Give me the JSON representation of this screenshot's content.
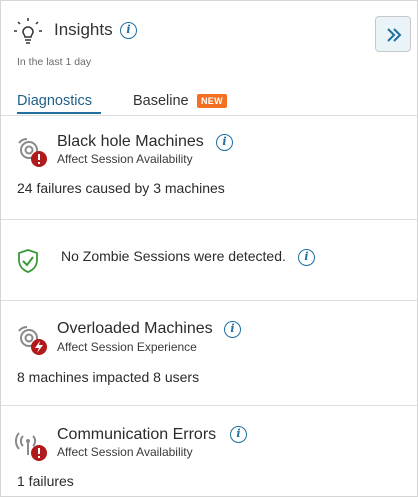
{
  "header": {
    "title": "Insights",
    "subtitle": "In the last 1 day",
    "icon": "lightbulb-icon",
    "collapse_icon": "double-chevron-right-icon"
  },
  "tabs": [
    {
      "label": "Diagnostics",
      "active": true
    },
    {
      "label": "Baseline",
      "badge": "NEW"
    }
  ],
  "cards": [
    {
      "title": "Black hole Machines",
      "subtitle": "Affect Session Availability",
      "detail": "24 failures caused by 3 machines",
      "icon": "black-hole-machines-error-icon"
    },
    {
      "message": "No Zombie Sessions were detected.",
      "icon": "shield-check-icon"
    },
    {
      "title": "Overloaded Machines",
      "subtitle": "Affect Session Experience",
      "detail": "8 machines impacted 8 users",
      "icon": "overloaded-machines-icon"
    },
    {
      "title": "Communication Errors",
      "subtitle": "Affect Session Availability",
      "detail": "1 failures",
      "icon": "communication-error-icon"
    }
  ],
  "colors": {
    "accent": "#1f6f9f",
    "badge": "#f36f21",
    "error": "#b01a1a",
    "success": "#3a9a3a"
  }
}
